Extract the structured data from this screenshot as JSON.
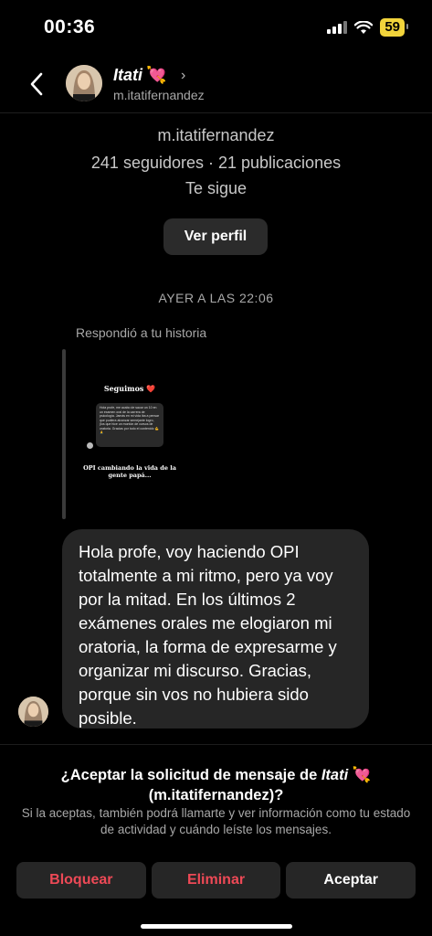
{
  "status_bar": {
    "time": "00:36",
    "battery": "59",
    "accent": "#f2d43b"
  },
  "header": {
    "name": "Itati",
    "heart": "💘",
    "chevron": "›",
    "handle": "m.itatifernandez"
  },
  "profile_summary": {
    "handle": "m.itatifernandez",
    "stats": "241 seguidores · 21 publicaciones",
    "follows_you": "Te sigue",
    "view_profile_label": "Ver perfil"
  },
  "conversation": {
    "date_separator": "AYER A LAS 22:06",
    "reply_note": "Respondió a tu historia",
    "story": {
      "title": "Seguimos ❤️",
      "card_text": "Hola profe, me acabo de sacar un 10 en un examen oral de la carrera de psicología. Jamás en mi vida iba a pensar que pudiera alcanzar semejante logro, (los que hice un montón de cursos de oratoria. Gracias por todo el contenido 💪🙏",
      "caption": "OPI cambiando la vida de la gente papá..."
    },
    "message": "Hola profe, voy haciendo OPI totalmente a mi ritmo, pero ya voy por la mitad. En los últimos 2 exámenes orales me elogiaron mi oratoria, la forma de expresarme y organizar mi discurso. Gracias, porque sin vos no hubiera sido posible."
  },
  "request": {
    "title_prefix": "¿Aceptar la solicitud de mensaje de",
    "title_name": "Itati",
    "title_heart": "💘",
    "title_handle": "(m.itatifernandez)?",
    "description": "Si la aceptas, también podrá llamarte y ver información como tu estado de actividad y cuándo leíste los mensajes.",
    "block_label": "Bloquear",
    "delete_label": "Eliminar",
    "accept_label": "Aceptar",
    "danger_color": "#ed4956"
  }
}
